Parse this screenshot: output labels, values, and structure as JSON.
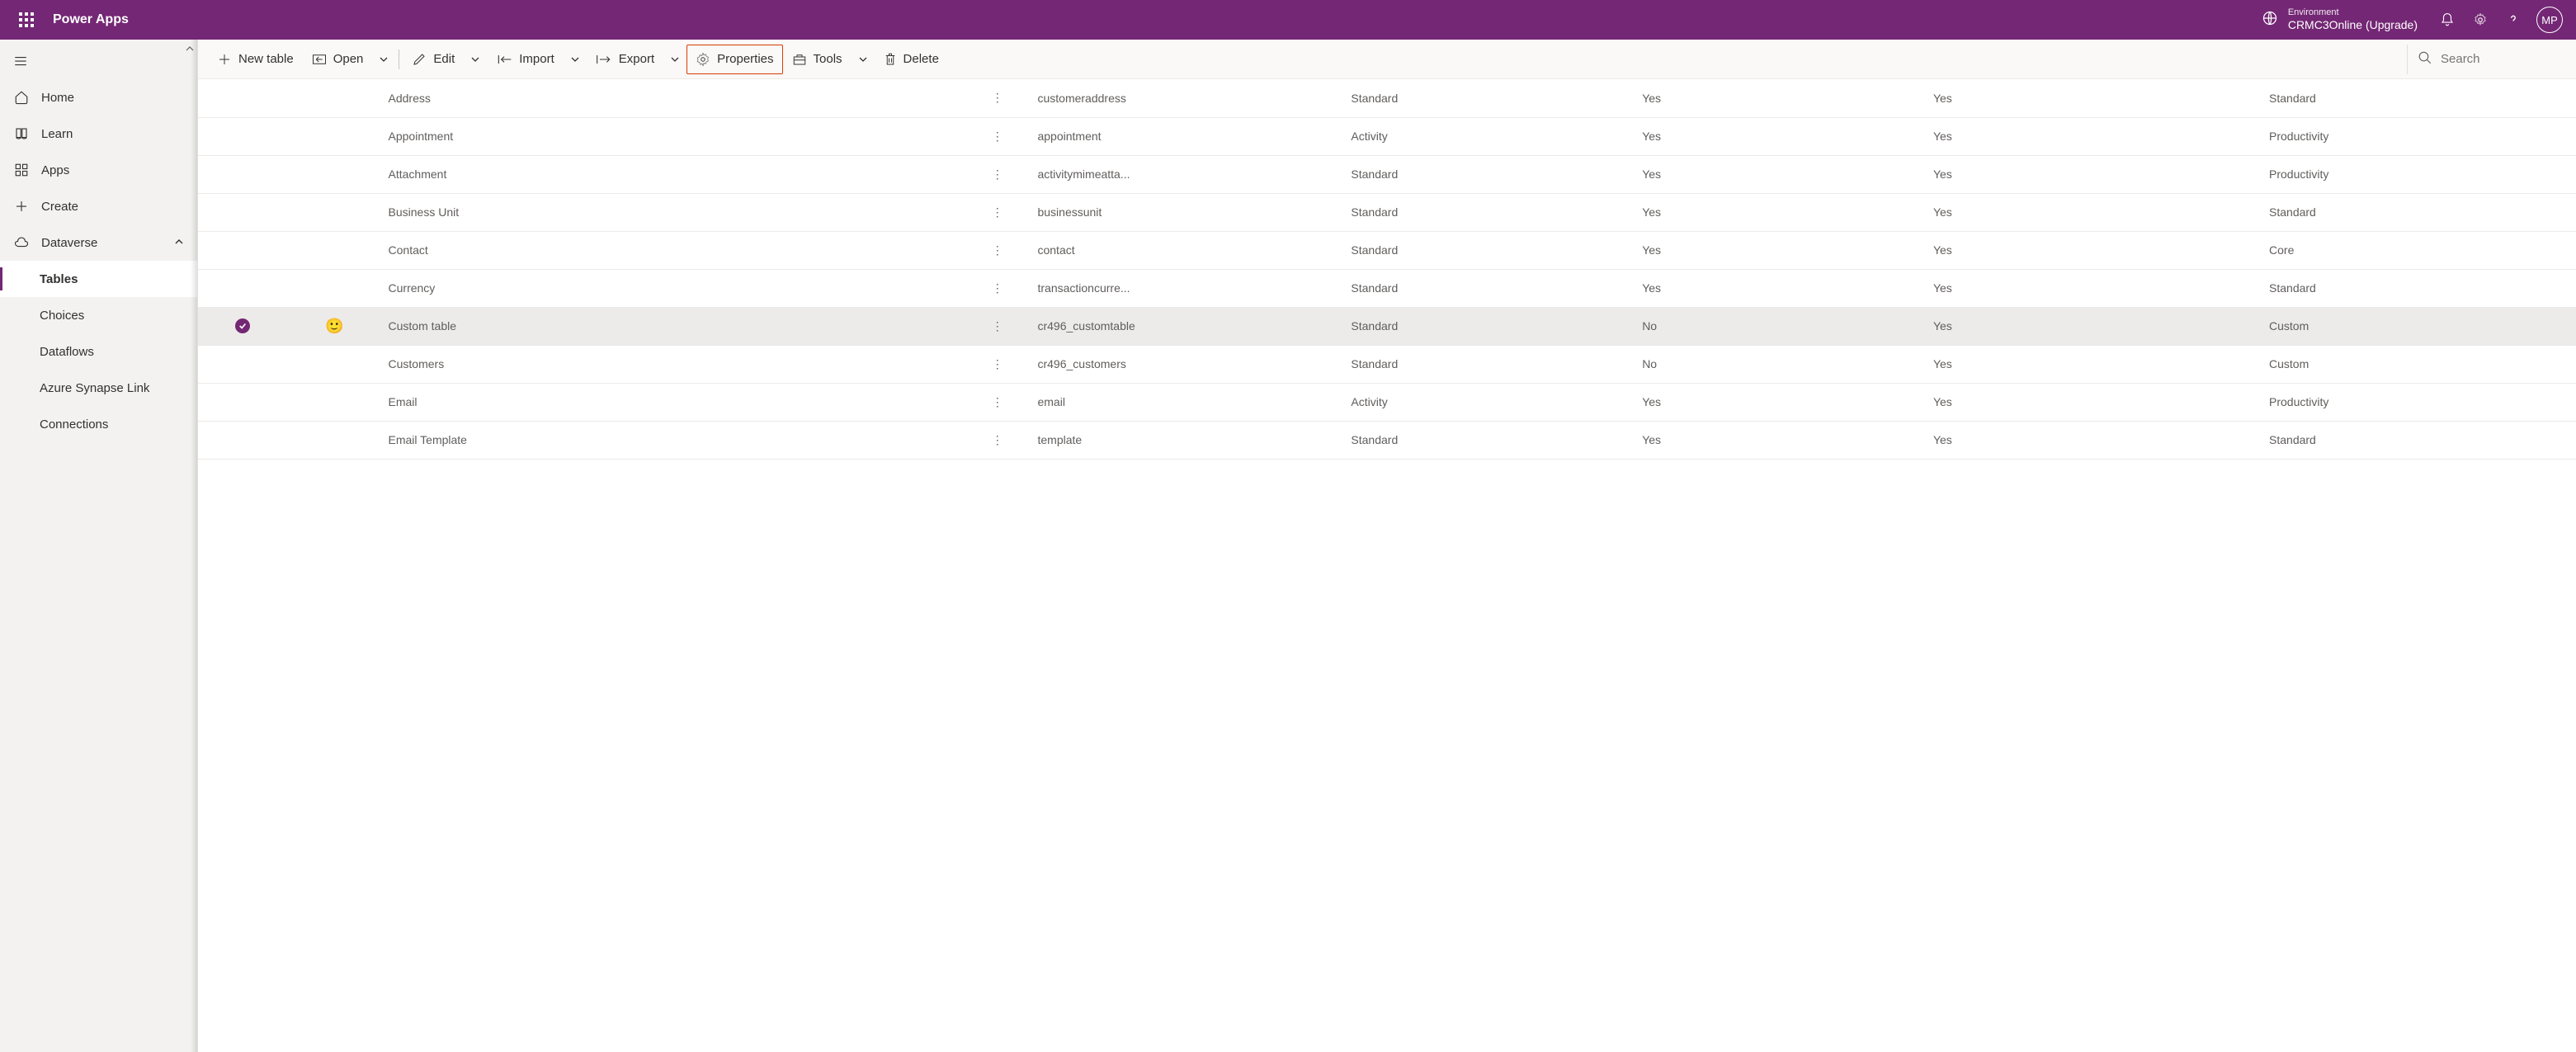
{
  "header": {
    "app_title": "Power Apps",
    "env_label": "Environment",
    "env_name": "CRMC3Online (Upgrade)",
    "avatar_initials": "MP"
  },
  "nav": {
    "items": [
      {
        "icon": "home",
        "label": "Home"
      },
      {
        "icon": "book",
        "label": "Learn"
      },
      {
        "icon": "grid",
        "label": "Apps"
      },
      {
        "icon": "plus",
        "label": "Create"
      },
      {
        "icon": "dataverse",
        "label": "Dataverse",
        "expandable": true
      }
    ],
    "sub_items": [
      {
        "label": "Tables",
        "active": true
      },
      {
        "label": "Choices"
      },
      {
        "label": "Dataflows"
      },
      {
        "label": "Azure Synapse Link"
      },
      {
        "label": "Connections"
      }
    ]
  },
  "commands": {
    "new_table": "New table",
    "open": "Open",
    "edit": "Edit",
    "import": "Import",
    "export": "Export",
    "properties": "Properties",
    "tools": "Tools",
    "delete": "Delete",
    "search_placeholder": "Search"
  },
  "table": {
    "rows": [
      {
        "display": "Address",
        "name": "customeraddress",
        "type": "Standard",
        "managed": "Yes",
        "customizable": "Yes",
        "tags": "Standard"
      },
      {
        "display": "Appointment",
        "name": "appointment",
        "type": "Activity",
        "managed": "Yes",
        "customizable": "Yes",
        "tags": "Productivity"
      },
      {
        "display": "Attachment",
        "name": "activitymimeatta...",
        "type": "Standard",
        "managed": "Yes",
        "customizable": "Yes",
        "tags": "Productivity"
      },
      {
        "display": "Business Unit",
        "name": "businessunit",
        "type": "Standard",
        "managed": "Yes",
        "customizable": "Yes",
        "tags": "Standard"
      },
      {
        "display": "Contact",
        "name": "contact",
        "type": "Standard",
        "managed": "Yes",
        "customizable": "Yes",
        "tags": "Core"
      },
      {
        "display": "Currency",
        "name": "transactioncurre...",
        "type": "Standard",
        "managed": "Yes",
        "customizable": "Yes",
        "tags": "Standard"
      },
      {
        "display": "Custom table",
        "name": "cr496_customtable",
        "type": "Standard",
        "managed": "No",
        "customizable": "Yes",
        "tags": "Custom",
        "selected": true,
        "emoji": "🙂"
      },
      {
        "display": "Customers",
        "name": "cr496_customers",
        "type": "Standard",
        "managed": "No",
        "customizable": "Yes",
        "tags": "Custom"
      },
      {
        "display": "Email",
        "name": "email",
        "type": "Activity",
        "managed": "Yes",
        "customizable": "Yes",
        "tags": "Productivity"
      },
      {
        "display": "Email Template",
        "name": "template",
        "type": "Standard",
        "managed": "Yes",
        "customizable": "Yes",
        "tags": "Standard"
      }
    ]
  }
}
